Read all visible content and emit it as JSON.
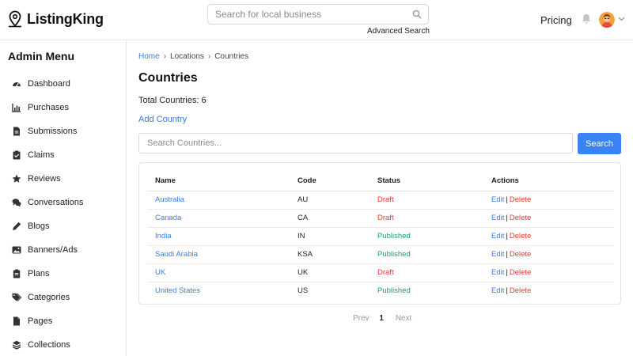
{
  "header": {
    "logo_text": "ListingKing",
    "search_placeholder": "Search for local business",
    "advanced_search": "Advanced Search",
    "pricing": "Pricing",
    "icons": [
      "map-pin-logo-icon",
      "search-icon",
      "bell-icon",
      "avatar",
      "chevron-down-icon"
    ]
  },
  "sidebar": {
    "title": "Admin Menu",
    "items": [
      {
        "label": "Dashboard",
        "icon": "dashboard-icon"
      },
      {
        "label": "Purchases",
        "icon": "chart-icon"
      },
      {
        "label": "Submissions",
        "icon": "document-icon"
      },
      {
        "label": "Claims",
        "icon": "clipboard-check-icon"
      },
      {
        "label": "Reviews",
        "icon": "star-icon"
      },
      {
        "label": "Conversations",
        "icon": "comments-icon"
      },
      {
        "label": "Blogs",
        "icon": "pencil-icon"
      },
      {
        "label": "Banners/Ads",
        "icon": "image-icon"
      },
      {
        "label": "Plans",
        "icon": "clipboard-icon"
      },
      {
        "label": "Categories",
        "icon": "tags-icon"
      },
      {
        "label": "Pages",
        "icon": "file-icon"
      },
      {
        "label": "Collections",
        "icon": "layers-icon"
      }
    ]
  },
  "main": {
    "breadcrumb": [
      "Home",
      "Locations",
      "Countries"
    ],
    "title": "Countries",
    "total": "Total Countries: 6",
    "add_link": "Add Country",
    "search_placeholder": "Search Countries...",
    "search_button": "Search",
    "table": {
      "headers": [
        "Name",
        "Code",
        "Status",
        "Actions"
      ],
      "rows": [
        {
          "name": "Australia",
          "code": "AU",
          "status": "Draft"
        },
        {
          "name": "Canada",
          "code": "CA",
          "status": "Draft"
        },
        {
          "name": "India",
          "code": "IN",
          "status": "Published"
        },
        {
          "name": "Saudi Arabia",
          "code": "KSA",
          "status": "Published"
        },
        {
          "name": "UK",
          "code": "UK",
          "status": "Draft"
        },
        {
          "name": "United States",
          "code": "US",
          "status": "Published"
        }
      ],
      "edit_label": "Edit",
      "delete_label": "Delete",
      "action_separator": "|"
    },
    "pagination": {
      "prev": "Prev",
      "current": "1",
      "next": "Next"
    }
  },
  "colors": {
    "link": "#3b7ddd",
    "primary_button": "#3b82f6",
    "draft": "#e53935",
    "published": "#1aa260",
    "delete": "#e53935"
  }
}
